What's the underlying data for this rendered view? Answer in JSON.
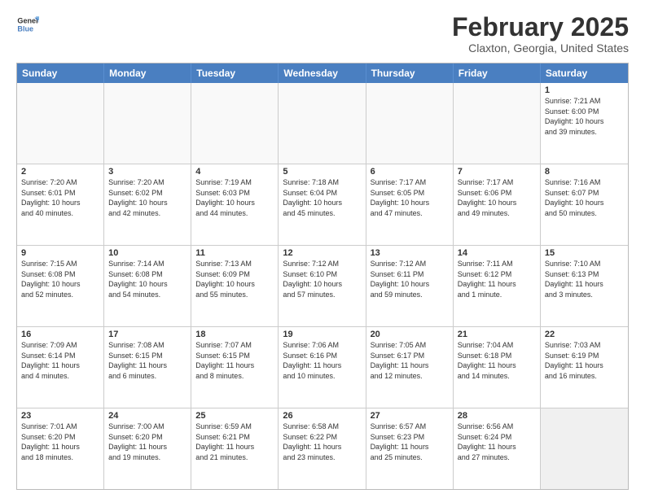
{
  "logo": {
    "line1": "General",
    "line2": "Blue"
  },
  "title": "February 2025",
  "subtitle": "Claxton, Georgia, United States",
  "days": [
    "Sunday",
    "Monday",
    "Tuesday",
    "Wednesday",
    "Thursday",
    "Friday",
    "Saturday"
  ],
  "rows": [
    [
      {
        "num": "",
        "info": ""
      },
      {
        "num": "",
        "info": ""
      },
      {
        "num": "",
        "info": ""
      },
      {
        "num": "",
        "info": ""
      },
      {
        "num": "",
        "info": ""
      },
      {
        "num": "",
        "info": ""
      },
      {
        "num": "1",
        "info": "Sunrise: 7:21 AM\nSunset: 6:00 PM\nDaylight: 10 hours\nand 39 minutes."
      }
    ],
    [
      {
        "num": "2",
        "info": "Sunrise: 7:20 AM\nSunset: 6:01 PM\nDaylight: 10 hours\nand 40 minutes."
      },
      {
        "num": "3",
        "info": "Sunrise: 7:20 AM\nSunset: 6:02 PM\nDaylight: 10 hours\nand 42 minutes."
      },
      {
        "num": "4",
        "info": "Sunrise: 7:19 AM\nSunset: 6:03 PM\nDaylight: 10 hours\nand 44 minutes."
      },
      {
        "num": "5",
        "info": "Sunrise: 7:18 AM\nSunset: 6:04 PM\nDaylight: 10 hours\nand 45 minutes."
      },
      {
        "num": "6",
        "info": "Sunrise: 7:17 AM\nSunset: 6:05 PM\nDaylight: 10 hours\nand 47 minutes."
      },
      {
        "num": "7",
        "info": "Sunrise: 7:17 AM\nSunset: 6:06 PM\nDaylight: 10 hours\nand 49 minutes."
      },
      {
        "num": "8",
        "info": "Sunrise: 7:16 AM\nSunset: 6:07 PM\nDaylight: 10 hours\nand 50 minutes."
      }
    ],
    [
      {
        "num": "9",
        "info": "Sunrise: 7:15 AM\nSunset: 6:08 PM\nDaylight: 10 hours\nand 52 minutes."
      },
      {
        "num": "10",
        "info": "Sunrise: 7:14 AM\nSunset: 6:08 PM\nDaylight: 10 hours\nand 54 minutes."
      },
      {
        "num": "11",
        "info": "Sunrise: 7:13 AM\nSunset: 6:09 PM\nDaylight: 10 hours\nand 55 minutes."
      },
      {
        "num": "12",
        "info": "Sunrise: 7:12 AM\nSunset: 6:10 PM\nDaylight: 10 hours\nand 57 minutes."
      },
      {
        "num": "13",
        "info": "Sunrise: 7:12 AM\nSunset: 6:11 PM\nDaylight: 10 hours\nand 59 minutes."
      },
      {
        "num": "14",
        "info": "Sunrise: 7:11 AM\nSunset: 6:12 PM\nDaylight: 11 hours\nand 1 minute."
      },
      {
        "num": "15",
        "info": "Sunrise: 7:10 AM\nSunset: 6:13 PM\nDaylight: 11 hours\nand 3 minutes."
      }
    ],
    [
      {
        "num": "16",
        "info": "Sunrise: 7:09 AM\nSunset: 6:14 PM\nDaylight: 11 hours\nand 4 minutes."
      },
      {
        "num": "17",
        "info": "Sunrise: 7:08 AM\nSunset: 6:15 PM\nDaylight: 11 hours\nand 6 minutes."
      },
      {
        "num": "18",
        "info": "Sunrise: 7:07 AM\nSunset: 6:15 PM\nDaylight: 11 hours\nand 8 minutes."
      },
      {
        "num": "19",
        "info": "Sunrise: 7:06 AM\nSunset: 6:16 PM\nDaylight: 11 hours\nand 10 minutes."
      },
      {
        "num": "20",
        "info": "Sunrise: 7:05 AM\nSunset: 6:17 PM\nDaylight: 11 hours\nand 12 minutes."
      },
      {
        "num": "21",
        "info": "Sunrise: 7:04 AM\nSunset: 6:18 PM\nDaylight: 11 hours\nand 14 minutes."
      },
      {
        "num": "22",
        "info": "Sunrise: 7:03 AM\nSunset: 6:19 PM\nDaylight: 11 hours\nand 16 minutes."
      }
    ],
    [
      {
        "num": "23",
        "info": "Sunrise: 7:01 AM\nSunset: 6:20 PM\nDaylight: 11 hours\nand 18 minutes."
      },
      {
        "num": "24",
        "info": "Sunrise: 7:00 AM\nSunset: 6:20 PM\nDaylight: 11 hours\nand 19 minutes."
      },
      {
        "num": "25",
        "info": "Sunrise: 6:59 AM\nSunset: 6:21 PM\nDaylight: 11 hours\nand 21 minutes."
      },
      {
        "num": "26",
        "info": "Sunrise: 6:58 AM\nSunset: 6:22 PM\nDaylight: 11 hours\nand 23 minutes."
      },
      {
        "num": "27",
        "info": "Sunrise: 6:57 AM\nSunset: 6:23 PM\nDaylight: 11 hours\nand 25 minutes."
      },
      {
        "num": "28",
        "info": "Sunrise: 6:56 AM\nSunset: 6:24 PM\nDaylight: 11 hours\nand 27 minutes."
      },
      {
        "num": "",
        "info": ""
      }
    ]
  ]
}
